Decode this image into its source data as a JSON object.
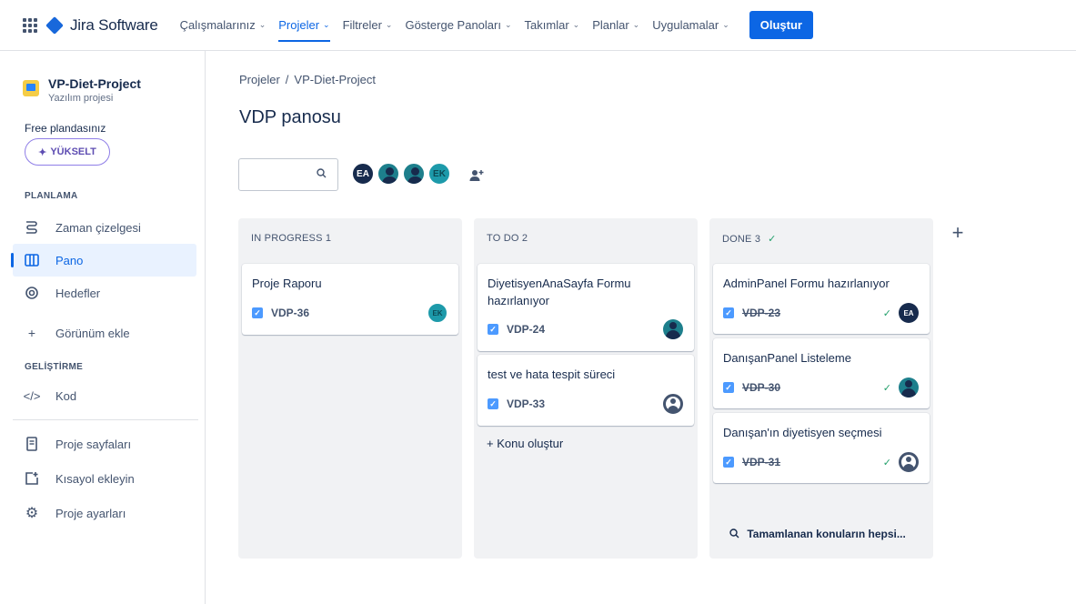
{
  "topnav": {
    "app_name": "Jira Software",
    "items": [
      {
        "label": "Çalışmalarınız",
        "chev": "⌄"
      },
      {
        "label": "Projeler",
        "chev": "⌄"
      },
      {
        "label": "Filtreler",
        "chev": "⌄"
      },
      {
        "label": "Gösterge Panoları",
        "chev": "⌄"
      },
      {
        "label": "Takımlar",
        "chev": "⌄"
      },
      {
        "label": "Planlar",
        "chev": "⌄"
      },
      {
        "label": "Uygulamalar",
        "chev": "⌄"
      }
    ],
    "create_label": "Oluştur",
    "accent": "#0c66e4"
  },
  "sidebar": {
    "project_name": "VP-Diet-Project",
    "project_type": "Yazılım projesi",
    "free_plan": "Free plandasınız",
    "upgrade": "YÜKSELT",
    "sections": {
      "planning": "PLANLAMA",
      "development": "GELİŞTİRME"
    },
    "items": {
      "timeline": "Zaman çizelgesi",
      "board": "Pano",
      "goals": "Hedefler",
      "add_view": "Görünüm ekle",
      "code": "Kod",
      "pages": "Proje sayfaları",
      "shortcut": "Kısayol ekleyin",
      "settings": "Proje ayarları"
    }
  },
  "main": {
    "breadcrumb": {
      "root": "Projeler",
      "sep": "/",
      "project": "VP-Diet-Project"
    },
    "title": "VDP panosu",
    "search": {
      "value": "",
      "placeholder": ""
    },
    "avatars": [
      {
        "initials": "EA"
      },
      {
        "initials": ""
      },
      {
        "initials": ""
      },
      {
        "initials": "EK"
      }
    ]
  },
  "columns": [
    {
      "title": "IN PROGRESS 1",
      "cards": [
        {
          "title": "Proje Raporu",
          "key": "VDP-36",
          "assignee": "EK",
          "done": false
        }
      ]
    },
    {
      "title": "TO DO 2",
      "cards": [
        {
          "title": "DiyetisyenAnaSayfa Formu hazırlanıyor",
          "key": "VDP-24",
          "assignee": "",
          "done": false
        },
        {
          "title": "test ve hata tespit süreci",
          "key": "VDP-33",
          "assignee": "",
          "done": false
        }
      ],
      "create_issue": "+ Konu oluştur"
    },
    {
      "title": "DONE 3",
      "cards": [
        {
          "title": "AdminPanel Formu hazırlanıyor",
          "key": "VDP-23",
          "assignee": "EA",
          "done": true
        },
        {
          "title": "DanışanPanel Listeleme",
          "key": "VDP-30",
          "assignee": "",
          "done": true
        },
        {
          "title": "Danışan'ın diyetisyen seçmesi",
          "key": "VDP-31",
          "assignee": "",
          "done": true
        }
      ],
      "all_done": "Tamamlanan konuların hepsi..."
    }
  ]
}
